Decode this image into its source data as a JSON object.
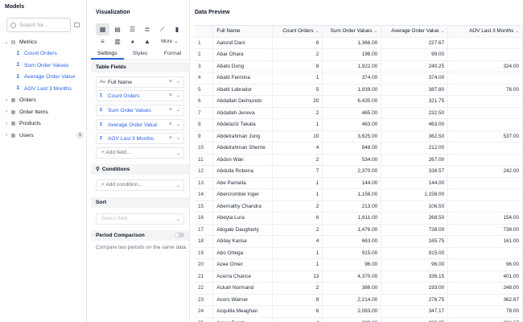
{
  "models": {
    "title": "Models",
    "search_placeholder": "Search for...",
    "tree": [
      {
        "label": "Metrics",
        "icon": "metrics-icon",
        "expanded": true,
        "children": [
          {
            "label": "Count Orders"
          },
          {
            "label": "Sum Order Values"
          },
          {
            "label": "Average Order Value"
          },
          {
            "label": "AOV Last 3 Months"
          }
        ]
      },
      {
        "label": "Orders",
        "icon": "table-icon",
        "expanded": false
      },
      {
        "label": "Order Items",
        "icon": "table-icon",
        "expanded": false
      },
      {
        "label": "Products",
        "icon": "table-icon",
        "expanded": false
      },
      {
        "label": "Users",
        "icon": "table-icon",
        "expanded": false,
        "badge": "1"
      }
    ]
  },
  "visualization": {
    "title": "Visualization",
    "more_label": "More",
    "tabs": [
      "Settings",
      "Styles",
      "Format"
    ],
    "active_tab": "Settings",
    "table_fields_label": "Table Fields",
    "fields": [
      {
        "label": "Full Name",
        "type": "dimension",
        "type_icon": "Aa"
      },
      {
        "label": "Count Orders",
        "type": "measure",
        "type_icon": "Σ"
      },
      {
        "label": "Sum Order Values",
        "type": "measure",
        "type_icon": "Σ"
      },
      {
        "label": "Average Order Value",
        "type": "measure",
        "type_icon": "Σ"
      },
      {
        "label": "AOV Last 3 Months",
        "type": "measure",
        "type_icon": "Σ"
      }
    ],
    "add_field_label": "+ Add field...",
    "conditions_label": "Conditions",
    "add_condition_label": "+ Add condition...",
    "sort_label": "Sort",
    "sort_placeholder": "Select field",
    "period_comparison_label": "Period Comparison",
    "period_comparison_text": "Compare two periods on the same data."
  },
  "preview": {
    "title": "Data Preview",
    "columns": [
      "",
      "Full Name",
      "Count Orders",
      "Sum Order Values",
      "Average Order Value",
      "AOV Last 3 Months"
    ],
    "rows": [
      [
        "1",
        "Aalund Dani",
        "6",
        "1,366.00",
        "227.67",
        ""
      ],
      [
        "2",
        "Abar Ohara",
        "2",
        "198.00",
        "99.00",
        ""
      ],
      [
        "3",
        "Abato Dong",
        "8",
        "1,922.00",
        "240.25",
        "324.00"
      ],
      [
        "4",
        "Abatti Fermina",
        "1",
        "374.00",
        "374.00",
        ""
      ],
      [
        "5",
        "Abatti Labrador",
        "5",
        "1,939.00",
        "387.80",
        "76.00"
      ],
      [
        "6",
        "Abdallah Delmundo",
        "20",
        "6,435.00",
        "321.75",
        ""
      ],
      [
        "7",
        "Abdallah Jeneva",
        "2",
        "465.00",
        "232.50",
        ""
      ],
      [
        "8",
        "Abdelaziz Takata",
        "1",
        "463.00",
        "463.00",
        ""
      ],
      [
        "9",
        "Abdelrahman Jung",
        "10",
        "3,625.00",
        "362.50",
        "537.00"
      ],
      [
        "10",
        "Abdelrahman Sherrie",
        "4",
        "848.00",
        "212.00",
        ""
      ],
      [
        "11",
        "Abdon Wan",
        "2",
        "534.00",
        "267.00",
        ""
      ],
      [
        "12",
        "Abdulla Robena",
        "7",
        "2,370.00",
        "338.57",
        "242.00"
      ],
      [
        "13",
        "Abe Pamella",
        "1",
        "144.00",
        "144.00",
        ""
      ],
      [
        "14",
        "Abercrombie Inger",
        "1",
        "1,156.00",
        "1,156.00",
        ""
      ],
      [
        "15",
        "Abernathy Chandra",
        "2",
        "213.00",
        "106.50",
        ""
      ],
      [
        "16",
        "Abeyta Lura",
        "6",
        "1,611.00",
        "268.50",
        "154.00"
      ],
      [
        "17",
        "Abigale Daugherty",
        "2",
        "1,476.00",
        "738.00",
        "738.00"
      ],
      [
        "18",
        "Abilay Karisa",
        "4",
        "663.00",
        "165.75",
        "161.00"
      ],
      [
        "19",
        "Abo Ortega",
        "1",
        "915.00",
        "915.00",
        ""
      ],
      [
        "20",
        "Acee Omer",
        "1",
        "96.00",
        "96.00",
        "96.00"
      ],
      [
        "21",
        "Acerra Chance",
        "13",
        "4,370.00",
        "336.15",
        "401.00"
      ],
      [
        "22",
        "Ackah Normand",
        "2",
        "386.00",
        "193.00",
        "248.00"
      ],
      [
        "23",
        "Acors Warner",
        "8",
        "2,214.00",
        "276.75",
        "362.67"
      ],
      [
        "24",
        "Acquilla Meaghan",
        "6",
        "2,083.00",
        "347.17",
        "78.00"
      ],
      [
        "25",
        "Acres Freida",
        "4",
        "809.00",
        "202.25",
        "224.67"
      ]
    ]
  },
  "colors": {
    "accent": "#2563eb",
    "border": "#e5e7eb",
    "section_bg": "#f3f4f6"
  }
}
